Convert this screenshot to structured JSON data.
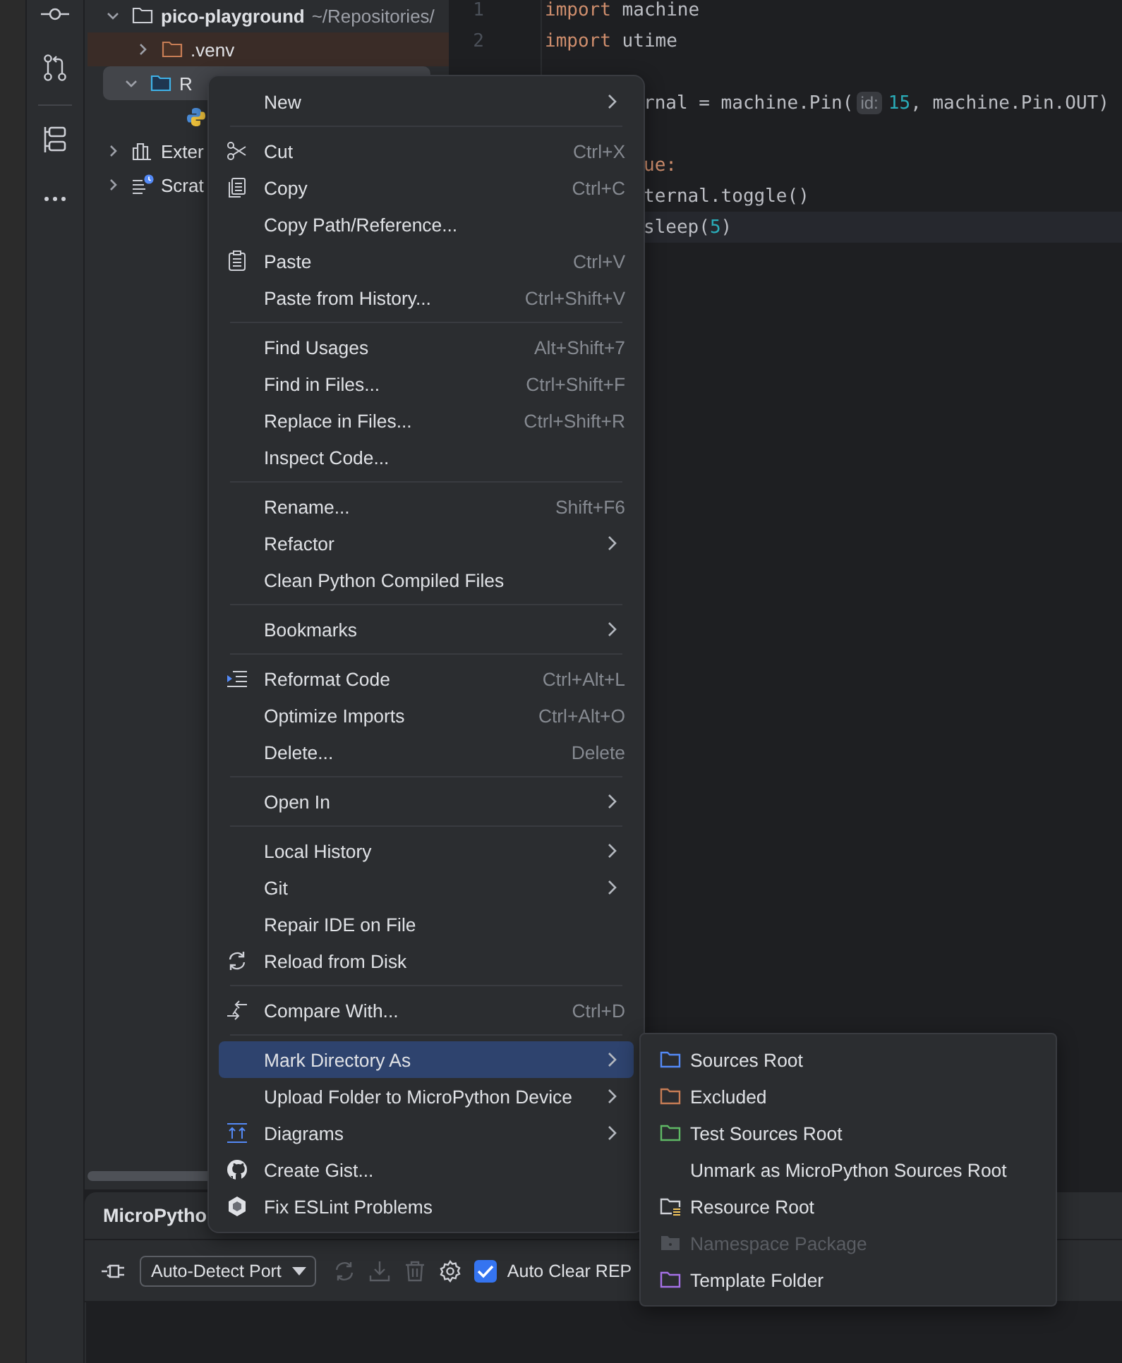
{
  "project_tree": [
    {
      "label": "pico-playground",
      "detail": "~/Repositories/",
      "kind": "folder",
      "expanded": true,
      "selected": false,
      "children": [
        {
          "label": ".venv",
          "kind": "excluded-folder",
          "expanded": false,
          "selected": false
        },
        {
          "label": "R",
          "kind": "source-folder",
          "expanded": true,
          "selected": true,
          "children": [
            {
              "kind": "python-file",
              "selected": false
            }
          ]
        }
      ]
    },
    {
      "label": "Exter",
      "kind": "library",
      "expanded": false,
      "selected": false
    },
    {
      "label": "Scrat",
      "kind": "scratches",
      "expanded": false,
      "selected": false
    }
  ],
  "editor": {
    "lines": [
      {
        "number": "1",
        "current": false,
        "tokens": [
          {
            "kind": "keyword",
            "text": "import"
          },
          {
            "kind": "plain",
            "text": " machine"
          }
        ]
      },
      {
        "number": "2",
        "current": false,
        "tokens": [
          {
            "kind": "keyword",
            "text": "import"
          },
          {
            "kind": "plain",
            "text": " utime"
          }
        ]
      },
      {
        "current": false
      },
      {
        "current": false,
        "tokens": [
          {
            "kind": "plain",
            "text": "rnal = machine.Pin("
          },
          {
            "kind": "hint",
            "text": "id:"
          },
          {
            "kind": "number",
            "text": "15"
          },
          {
            "kind": "plain",
            "text": ", machine.Pin.OUT)"
          }
        ]
      },
      {
        "current": false
      },
      {
        "current": false,
        "tokens": [
          {
            "kind": "keyword",
            "text": "ue:"
          }
        ]
      },
      {
        "current": false,
        "tokens": [
          {
            "kind": "plain",
            "text": "ternal.toggle()"
          }
        ]
      },
      {
        "current": true,
        "tokens": [
          {
            "kind": "plain",
            "text": "sleep("
          },
          {
            "kind": "number",
            "text": "5"
          },
          {
            "kind": "plain",
            "text": ")"
          }
        ]
      }
    ]
  },
  "tool_window": {
    "title": "MicroPytho",
    "port_dropdown": {
      "value": "Auto-Detect Port"
    },
    "tools": [
      {
        "kind": "refresh",
        "disabled": true
      },
      {
        "kind": "download",
        "disabled": true
      },
      {
        "kind": "trash",
        "disabled": true
      },
      {
        "kind": "settings",
        "disabled": false
      }
    ],
    "auto_clear": {
      "label": "Auto Clear REP",
      "checked": true
    }
  },
  "context_menu": {
    "groups": [
      {
        "items": [
          {
            "label": "New",
            "submenu": true,
            "selected": false
          }
        ]
      },
      {
        "items": [
          {
            "label": "Cut",
            "shortcut": "Ctrl+X",
            "kind": "scissors",
            "selected": false
          },
          {
            "label": "Copy",
            "shortcut": "Ctrl+C",
            "kind": "copy",
            "selected": false
          },
          {
            "label": "Copy Path/Reference...",
            "selected": false
          },
          {
            "label": "Paste",
            "shortcut": "Ctrl+V",
            "kind": "clipboard",
            "selected": false
          },
          {
            "label": "Paste from History...",
            "shortcut": "Ctrl+Shift+V",
            "selected": false
          }
        ]
      },
      {
        "items": [
          {
            "label": "Find Usages",
            "shortcut": "Alt+Shift+7",
            "selected": false
          },
          {
            "label": "Find in Files...",
            "shortcut": "Ctrl+Shift+F",
            "selected": false
          },
          {
            "label": "Replace in Files...",
            "shortcut": "Ctrl+Shift+R",
            "selected": false
          },
          {
            "label": "Inspect Code...",
            "selected": false
          }
        ]
      },
      {
        "items": [
          {
            "label": "Rename...",
            "shortcut": "Shift+F6",
            "selected": false
          },
          {
            "label": "Refactor",
            "submenu": true,
            "selected": false
          },
          {
            "label": "Clean Python Compiled Files",
            "selected": false
          }
        ]
      },
      {
        "items": [
          {
            "label": "Bookmarks",
            "submenu": true,
            "selected": false
          }
        ]
      },
      {
        "items": [
          {
            "label": "Reformat Code",
            "shortcut": "Ctrl+Alt+L",
            "kind": "reformat",
            "selected": false
          },
          {
            "label": "Optimize Imports",
            "shortcut": "Ctrl+Alt+O",
            "selected": false
          },
          {
            "label": "Delete...",
            "shortcut": "Delete",
            "selected": false
          }
        ]
      },
      {
        "items": [
          {
            "label": "Open In",
            "submenu": true,
            "selected": false
          }
        ]
      },
      {
        "items": [
          {
            "label": "Local History",
            "submenu": true,
            "selected": false
          },
          {
            "label": "Git",
            "submenu": true,
            "selected": false
          },
          {
            "label": "Repair IDE on File",
            "selected": false
          },
          {
            "label": "Reload from Disk",
            "kind": "reload",
            "selected": false
          }
        ]
      },
      {
        "items": [
          {
            "label": "Compare With...",
            "shortcut": "Ctrl+D",
            "kind": "compare",
            "selected": false
          }
        ]
      },
      {
        "items": [
          {
            "label": "Mark Directory As",
            "submenu": true,
            "selected": true
          },
          {
            "label": "Upload Folder to MicroPython Device",
            "submenu": true,
            "selected": false
          },
          {
            "label": "Diagrams",
            "submenu": true,
            "kind": "diagrams",
            "selected": false
          },
          {
            "label": "Create Gist...",
            "kind": "cat",
            "selected": false
          },
          {
            "label": "Fix ESLint Problems",
            "kind": "hexagon",
            "selected": false
          }
        ]
      }
    ]
  },
  "submenu": {
    "items": [
      {
        "label": "Sources Root",
        "kind": "folder",
        "color": "#548af7",
        "disabled": false
      },
      {
        "label": "Excluded",
        "kind": "folder",
        "color": "#c77d55",
        "disabled": false
      },
      {
        "label": "Test Sources Root",
        "kind": "folder",
        "color": "#5fb865",
        "disabled": false
      },
      {
        "label": "Unmark as MicroPython Sources Root",
        "disabled": false
      },
      {
        "label": "Resource Root",
        "kind": "resource",
        "disabled": false
      },
      {
        "label": "Namespace Package",
        "kind": "package",
        "disabled": true
      },
      {
        "label": "Template Folder",
        "kind": "folder",
        "color": "#a571e6",
        "disabled": false
      }
    ]
  }
}
